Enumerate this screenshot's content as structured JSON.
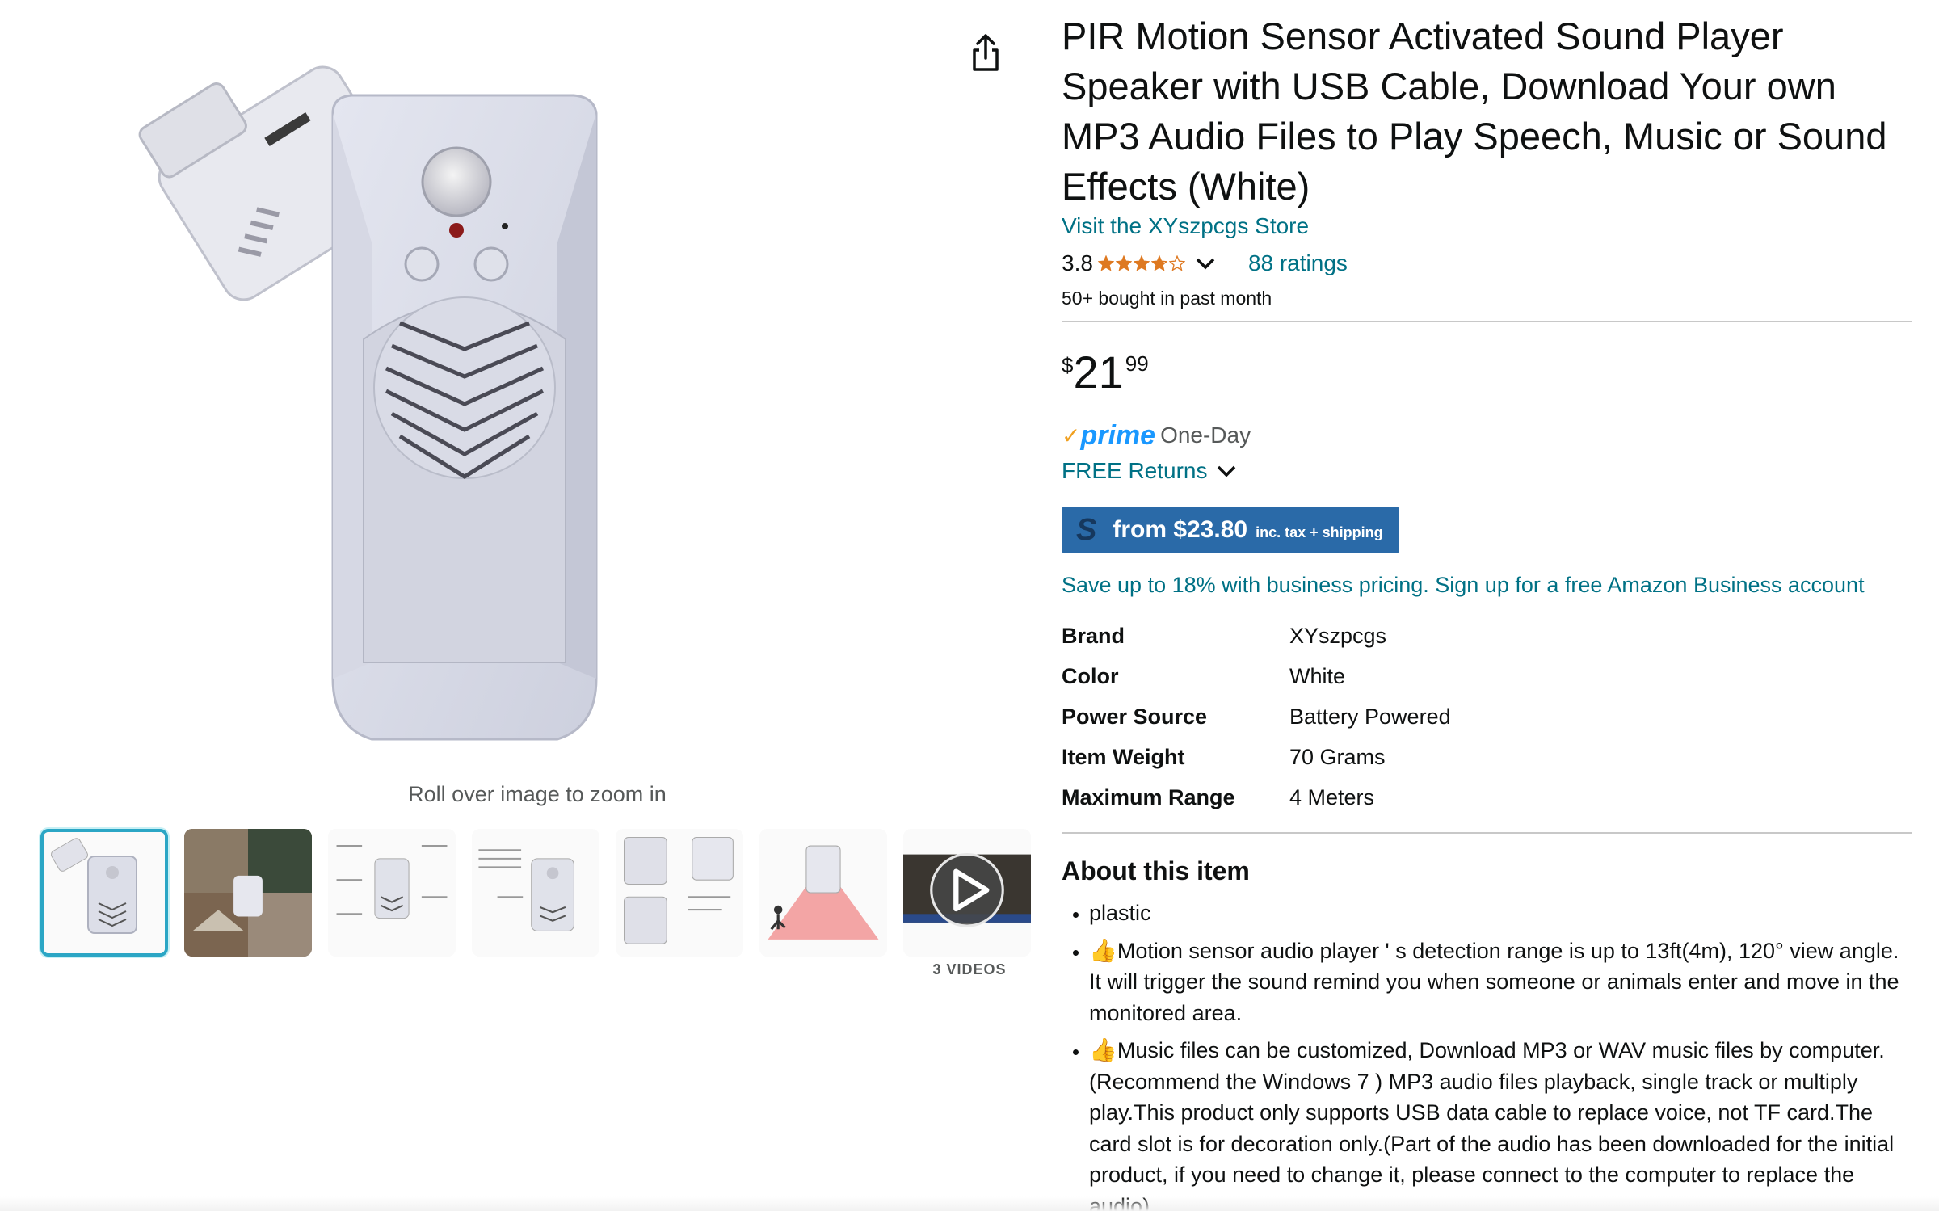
{
  "gallery": {
    "zoom_hint": "Roll over image to zoom in",
    "video_label": "3 VIDEOS",
    "thumbnails": [
      {
        "kind": "image",
        "active": true
      },
      {
        "kind": "image",
        "active": false
      },
      {
        "kind": "image",
        "active": false
      },
      {
        "kind": "image",
        "active": false
      },
      {
        "kind": "image",
        "active": false
      },
      {
        "kind": "image",
        "active": false
      },
      {
        "kind": "video",
        "active": false
      }
    ]
  },
  "product": {
    "title": "PIR Motion Sensor Activated Sound Player Speaker with USB Cable, Download Your own MP3 Audio Files to Play Speech, Music or Sound Effects (White)",
    "store_link": "Visit the XYszpcgs Store",
    "rating": "3.8",
    "rating_value": 3.8,
    "ratings_count": "88 ratings",
    "bought": "50+ bought in past month",
    "price": {
      "symbol": "$",
      "whole": "21",
      "fraction": "99"
    },
    "prime": {
      "check": "✓",
      "word": "prime",
      "delivery": "One-Day"
    },
    "returns": "FREE Returns",
    "business_button": {
      "logo": "S",
      "from": "from $23.80",
      "inc": "inc. tax + shipping"
    },
    "business_link": "Save up to 18% with business pricing. Sign up for a free Amazon Business account",
    "specs": [
      {
        "key": "Brand",
        "value": "XYszpcgs"
      },
      {
        "key": "Color",
        "value": "White"
      },
      {
        "key": "Power Source",
        "value": "Battery Powered"
      },
      {
        "key": "Item Weight",
        "value": "70 Grams"
      },
      {
        "key": "Maximum Range",
        "value": "4 Meters"
      }
    ],
    "about_title": "About this item",
    "bullets": [
      {
        "icon": "",
        "text": "plastic"
      },
      {
        "icon": "👍",
        "text": "Motion sensor audio player ' s detection range is up to 13ft(4m), 120° view angle. It will trigger the sound remind you when someone or animals enter and move in the monitored area."
      },
      {
        "icon": "👍",
        "text": "Music files can be customized, Download MP3 or WAV music files by computer.(Recommend the Windows 7 ) MP3 audio files playback, single track or multiply play.This product only supports USB data cable to replace voice, not TF card.The card slot is for decoration only.(Part of the audio has been downloaded for the initial product, if you need to change it, please connect to the computer to replace the audio)"
      }
    ]
  },
  "colors": {
    "link": "#007185",
    "star": "#de7921",
    "prime": "#1a98ff",
    "business": "#2a6aa8",
    "thumb_active": "#2ba6c5"
  },
  "icons": {
    "share": "share-icon",
    "chevron": "chevron-down-icon",
    "play": "play-icon"
  }
}
